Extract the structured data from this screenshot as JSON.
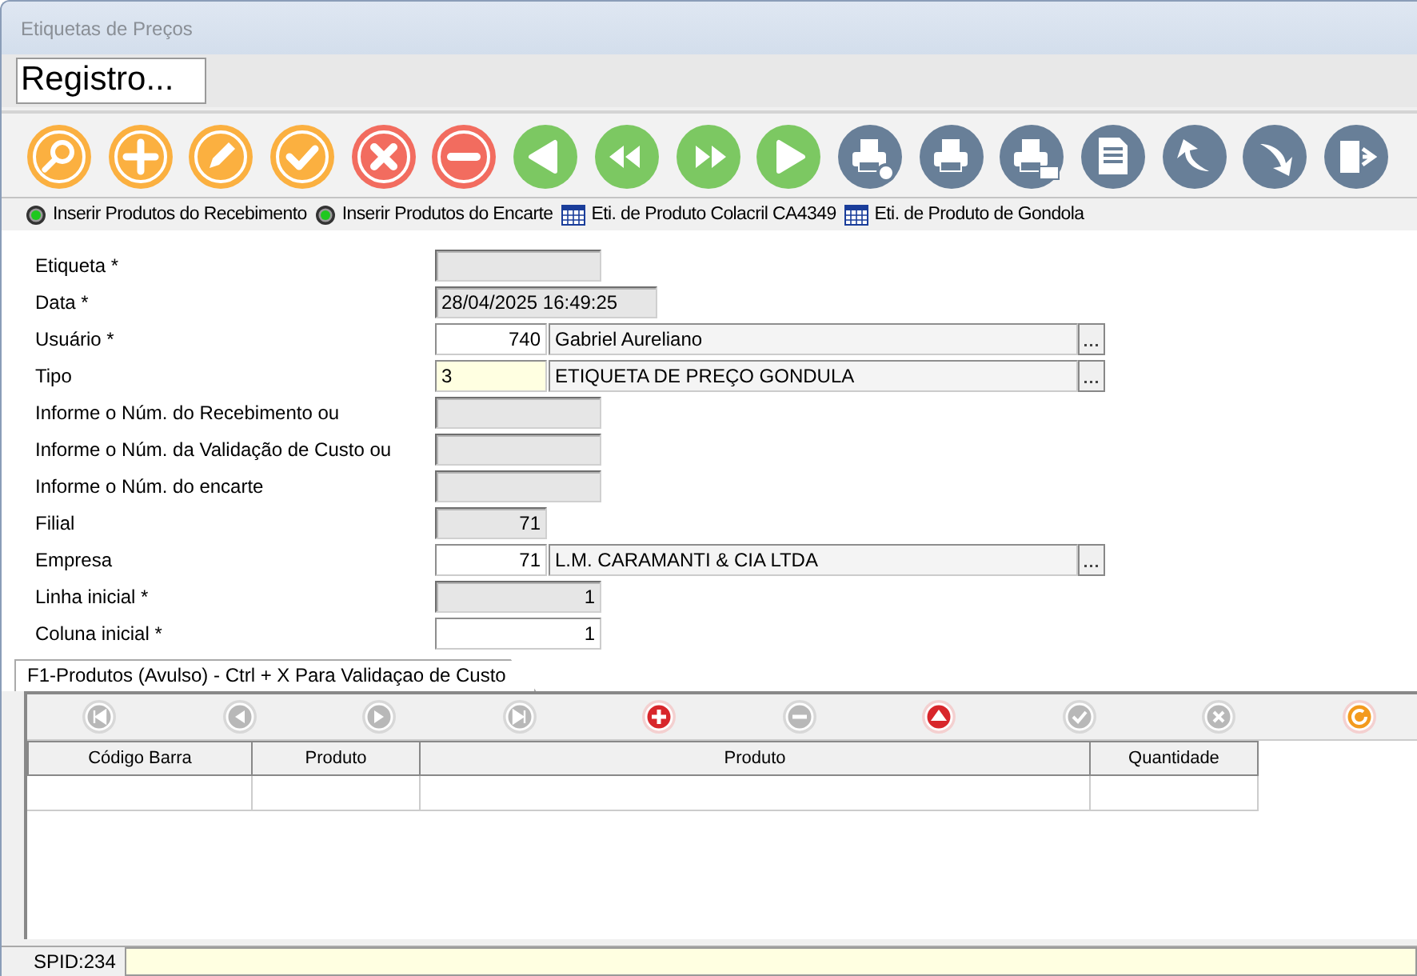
{
  "window": {
    "title": "Etiquetas de Preços"
  },
  "header": {
    "title": "Registro..."
  },
  "toolbar": [
    {
      "kind": "search"
    },
    {
      "kind": "add"
    },
    {
      "kind": "edit"
    },
    {
      "kind": "confirm"
    },
    {
      "kind": "cancel"
    },
    {
      "kind": "remove"
    },
    {
      "kind": "prev"
    },
    {
      "kind": "first"
    },
    {
      "kind": "last"
    },
    {
      "kind": "next"
    },
    {
      "kind": "print-preview"
    },
    {
      "kind": "print"
    },
    {
      "kind": "print-mail"
    },
    {
      "kind": "document"
    },
    {
      "kind": "undo"
    },
    {
      "kind": "redo"
    },
    {
      "kind": "export"
    }
  ],
  "links": [
    {
      "kind": "action",
      "label": "Inserir Produtos do Recebimento"
    },
    {
      "kind": "action",
      "label": "Inserir Produtos do Encarte"
    },
    {
      "kind": "report",
      "label": "Eti. de Produto Colacril CA4349"
    },
    {
      "kind": "report",
      "label": "Eti. de Produto de Gondola"
    }
  ],
  "form": [
    {
      "kind": "text",
      "label": "Etiqueta *",
      "disabled": true
    },
    {
      "kind": "datetime",
      "label": "Data *",
      "value": "28/04/2025 16:49:25",
      "disabled": true
    },
    {
      "kind": "lookup",
      "label": "Usuário *",
      "code": "740",
      "name": "Gabriel Aureliano",
      "focused": false
    },
    {
      "kind": "lookup",
      "label": "Tipo",
      "code": "3",
      "name": "ETIQUETA DE PREÇO GONDULA",
      "focused": true
    },
    {
      "kind": "text",
      "label": "Informe o Núm. do Recebimento ou",
      "disabled": true
    },
    {
      "kind": "text",
      "label": "Informe o Núm. da Validação de Custo ou",
      "disabled": true
    },
    {
      "kind": "text",
      "label": "Informe o Núm. do encarte",
      "disabled": true
    },
    {
      "kind": "code",
      "label": "Filial",
      "value": "71",
      "disabled": true
    },
    {
      "kind": "lookup",
      "label": "Empresa",
      "code": "71",
      "name": "L.M. CARAMANTI & CIA LTDA",
      "focused": false
    },
    {
      "kind": "number",
      "label": "Linha inicial *",
      "value": "1",
      "disabled": true
    },
    {
      "kind": "number",
      "label": "Coluna inicial *",
      "value": "1",
      "disabled": false
    }
  ],
  "tab": {
    "label": "F1-Produtos (Avulso) - Ctrl + X Para Validaçao de Custo",
    "selected": true
  },
  "navigator": [
    {
      "kind": "first",
      "disabled": true
    },
    {
      "kind": "prev",
      "disabled": true
    },
    {
      "kind": "next",
      "disabled": true
    },
    {
      "kind": "last",
      "disabled": true
    },
    {
      "kind": "add",
      "disabled": false
    },
    {
      "kind": "remove",
      "disabled": true
    },
    {
      "kind": "up",
      "disabled": false
    },
    {
      "kind": "confirm",
      "disabled": true
    },
    {
      "kind": "cancel",
      "disabled": true
    },
    {
      "kind": "refresh",
      "disabled": false
    }
  ],
  "table": {
    "columns": [
      "Código Barra",
      "Produto",
      "Produto",
      "Quantidade"
    ]
  },
  "status_bar": {
    "label": "SPID:234"
  }
}
